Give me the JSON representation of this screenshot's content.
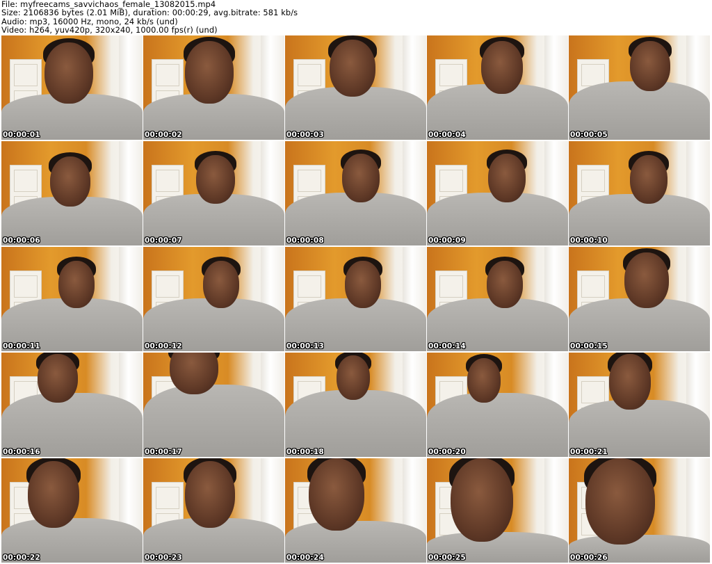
{
  "header": {
    "file_line": "File: myfreecams_savvichaos_female_13082015.mp4",
    "size_line": "Size: 2106836 bytes (2.01 MiB), duration: 00:00:29, avg.bitrate: 581 kb/s",
    "audio_line": "Audio: mp3, 16000 Hz, mono, 24 kb/s (und)",
    "video_line": "Video: h264, yuv420p, 320x240, 1000.00 fps(r) (und)"
  },
  "thumbnails": [
    {
      "timestamp": "00:00:01"
    },
    {
      "timestamp": "00:00:02"
    },
    {
      "timestamp": "00:00:03"
    },
    {
      "timestamp": "00:00:04"
    },
    {
      "timestamp": "00:00:05"
    },
    {
      "timestamp": "00:00:06"
    },
    {
      "timestamp": "00:00:07"
    },
    {
      "timestamp": "00:00:08"
    },
    {
      "timestamp": "00:00:09"
    },
    {
      "timestamp": "00:00:10"
    },
    {
      "timestamp": "00:00:11"
    },
    {
      "timestamp": "00:00:12"
    },
    {
      "timestamp": "00:00:13"
    },
    {
      "timestamp": "00:00:14"
    },
    {
      "timestamp": "00:00:15"
    },
    {
      "timestamp": "00:00:16"
    },
    {
      "timestamp": "00:00:17"
    },
    {
      "timestamp": "00:00:18"
    },
    {
      "timestamp": "00:00:20"
    },
    {
      "timestamp": "00:00:21"
    },
    {
      "timestamp": "00:00:22"
    },
    {
      "timestamp": "00:00:23"
    },
    {
      "timestamp": "00:00:24"
    },
    {
      "timestamp": "00:00:25"
    },
    {
      "timestamp": "00:00:26"
    }
  ],
  "colors": {
    "wall_orange": "#e39a2c",
    "door_white": "#f4f1ea",
    "shirt_gray": "#b9b7b3",
    "timestamp_text": "#ffffff"
  }
}
